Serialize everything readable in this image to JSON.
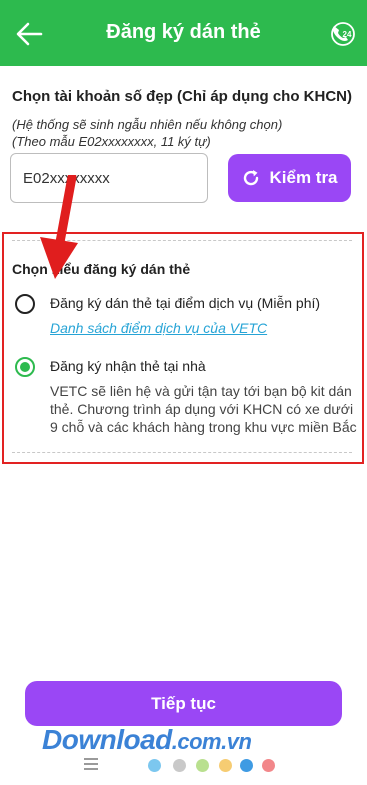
{
  "header": {
    "title": "Đăng ký dán thẻ"
  },
  "account": {
    "label": "Chọn tài khoản số đẹp (Chỉ áp dụng cho KHCN)",
    "hint1": "(Hệ thống sẽ sinh ngẫu nhiên nếu không chọn)",
    "hint2": "(Theo mẫu E02xxxxxxxx, 11 ký tự)",
    "input_value": "E02xxxxxxxx",
    "check_label": "Kiểm tra"
  },
  "options": {
    "title": "Chọn kiểu đăng ký dán thẻ",
    "option1": {
      "label": "Đăng ký dán thẻ tại điểm dịch vụ (Miễn phí)",
      "link": "Danh sách điểm dịch vụ của VETC",
      "selected": false
    },
    "option2": {
      "label": "Đăng ký nhận thẻ tại nhà",
      "description": "VETC sẽ liên hệ và gửi tận tay tới bạn bộ kit dán thẻ. Chương trình áp dụng với KHCN có xe dưới 9 chỗ và các khách hàng trong khu vực miền Bắc",
      "selected": true
    }
  },
  "footer": {
    "next_label": "Tiếp tục"
  },
  "watermark": {
    "brand": "Download",
    "suffix": ".com.vn"
  },
  "icons": {
    "back": "back-arrow-icon",
    "support": "phone-24-icon",
    "refresh": "refresh-icon"
  },
  "colors": {
    "header_green": "#2dba4e",
    "accent_purple": "#9a47f5",
    "link_blue": "#27a4d6",
    "highlight_red": "#e22222"
  },
  "navbar": {
    "dots": [
      "#7cc7ef",
      "#c9c9c9",
      "#b9e08f",
      "#f6cc72",
      "#3f9be3",
      "#f2878a"
    ]
  }
}
